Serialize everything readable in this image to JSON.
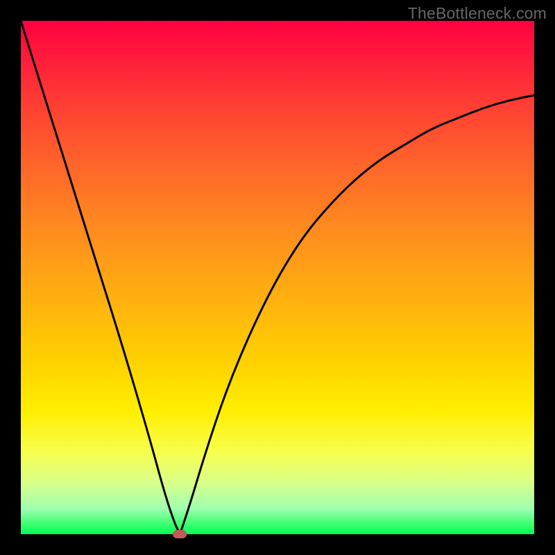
{
  "watermark": "TheBottleneck.com",
  "chart_data": {
    "type": "line",
    "title": "",
    "xlabel": "",
    "ylabel": "",
    "xlim": [
      0,
      100
    ],
    "ylim": [
      0,
      100
    ],
    "grid": false,
    "legend": false,
    "background": {
      "gradient": "vertical",
      "stops": [
        {
          "pos": 0,
          "color": "#ff0040"
        },
        {
          "pos": 18,
          "color": "#ff4432"
        },
        {
          "pos": 42,
          "color": "#ff8f1d"
        },
        {
          "pos": 66,
          "color": "#ffd000"
        },
        {
          "pos": 84,
          "color": "#f7ff4d"
        },
        {
          "pos": 95,
          "color": "#a0ffb0"
        },
        {
          "pos": 100,
          "color": "#00ff55"
        }
      ]
    },
    "series": [
      {
        "name": "left-branch",
        "x": [
          0,
          5,
          10,
          15,
          20,
          25,
          28,
          30,
          31
        ],
        "y": [
          100,
          84,
          68,
          52,
          36,
          19,
          8,
          2,
          0
        ]
      },
      {
        "name": "right-branch",
        "x": [
          31,
          33,
          36,
          40,
          45,
          50,
          55,
          60,
          65,
          70,
          75,
          80,
          85,
          90,
          95,
          100
        ],
        "y": [
          0,
          6,
          16,
          28,
          40,
          50,
          58,
          64,
          69,
          73,
          76,
          79,
          81,
          83,
          84.5,
          85.5
        ]
      }
    ],
    "marker": {
      "x": 31,
      "y": 0,
      "color": "#c45a5a",
      "shape": "rounded-rect"
    }
  },
  "colors": {
    "frame": "#000000",
    "curve": "#000000",
    "marker": "#c45a5a",
    "watermark": "#666666"
  }
}
